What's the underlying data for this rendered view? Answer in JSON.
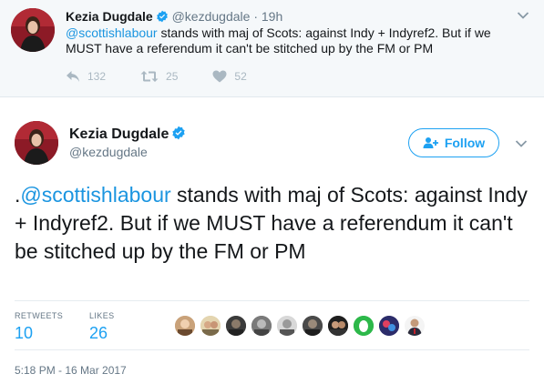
{
  "context_tweet": {
    "name": "Kezia Dugdale",
    "handle": "@kezdugdale",
    "separator": "·",
    "time": "19h",
    "mention": "@scottishlabour",
    "text": " stands with maj of Scots: against Indy + Indyref2. But if we MUST have a referendum it can't be stitched up by the FM or PM",
    "replies": "132",
    "retweets": "25",
    "likes": "52"
  },
  "main_tweet": {
    "name": "Kezia Dugdale",
    "handle": "@kezdugdale",
    "follow_label": "Follow",
    "text_prefix": ".",
    "mention": "@scottishlabour",
    "text": " stands with maj of Scots: against Indy + Indyref2. But if we MUST have a referendum it can't be stitched up by the FM or PM",
    "retweets_label": "RETWEETS",
    "retweets_count": "10",
    "likes_label": "LIKES",
    "likes_count": "26",
    "timestamp": "5:18 PM - 16 Mar 2017"
  },
  "colors": {
    "accent": "#1da1f2",
    "mention": "#1b95e0",
    "muted": "#657786",
    "verified": "#1da1f2"
  }
}
